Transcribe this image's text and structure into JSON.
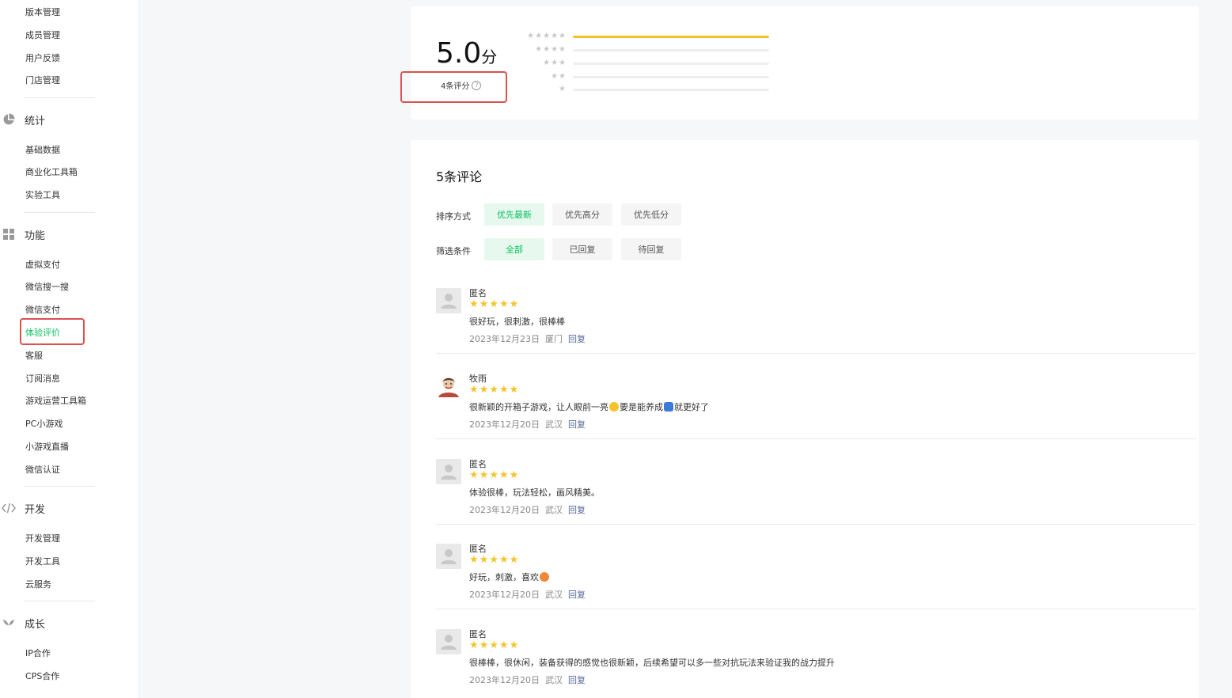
{
  "sidebar": {
    "items_top": [
      {
        "label": "版本管理"
      },
      {
        "label": "成员管理"
      },
      {
        "label": "用户反馈"
      },
      {
        "label": "门店管理"
      }
    ],
    "sections": [
      {
        "title": "统计",
        "icon": "pie-chart-icon",
        "items": [
          {
            "label": "基础数据"
          },
          {
            "label": "商业化工具箱"
          },
          {
            "label": "实验工具"
          }
        ]
      },
      {
        "title": "功能",
        "icon": "grid-icon",
        "items": [
          {
            "label": "虚拟支付"
          },
          {
            "label": "微信搜一搜"
          },
          {
            "label": "微信支付"
          },
          {
            "label": "体验评价",
            "active": true
          },
          {
            "label": "客服"
          },
          {
            "label": "订阅消息"
          },
          {
            "label": "游戏运营工具箱"
          },
          {
            "label": "PC小游戏"
          },
          {
            "label": "小游戏直播"
          },
          {
            "label": "微信认证"
          }
        ]
      },
      {
        "title": "开发",
        "icon": "code-icon",
        "items": [
          {
            "label": "开发管理"
          },
          {
            "label": "开发工具"
          },
          {
            "label": "云服务"
          }
        ]
      },
      {
        "title": "成长",
        "icon": "sprout-icon",
        "items": [
          {
            "label": "IP合作"
          },
          {
            "label": "CPS合作"
          }
        ]
      }
    ],
    "active_color": "#07c160"
  },
  "score": {
    "value": "5.0",
    "unit": "分",
    "count_label": "4条评分",
    "distribution": [
      {
        "stars": 5,
        "fraction": 1.0
      },
      {
        "stars": 4,
        "fraction": 0
      },
      {
        "stars": 3,
        "fraction": 0
      },
      {
        "stars": 2,
        "fraction": 0
      },
      {
        "stars": 1,
        "fraction": 0
      }
    ]
  },
  "comments": {
    "title": "5条评论",
    "sort_label": "排序方式",
    "sort_options": [
      "优先最新",
      "优先高分",
      "优先低分"
    ],
    "sort_selected": "优先最新",
    "filter_label": "筛选条件",
    "filter_options": [
      "全部",
      "已回复",
      "待回复"
    ],
    "filter_selected": "全部",
    "reply_label": "回复",
    "list": [
      {
        "author": "匿名",
        "rating": 5,
        "text": "很好玩，很刺激，很棒棒",
        "date": "2023年12月23日",
        "location": "厦门",
        "avatar": "default-avatar-icon"
      },
      {
        "author": "牧雨",
        "rating": 5,
        "text_parts": [
          "很新颖的开箱子游戏，让人眼前一亮",
          "要是能养成",
          "就更好了"
        ],
        "date": "2023年12月20日",
        "location": "武汉",
        "avatar": "user-avatar-image"
      },
      {
        "author": "匿名",
        "rating": 5,
        "text": "体验很棒，玩法轻松，画风精美。",
        "date": "2023年12月20日",
        "location": "武汉",
        "avatar": "default-avatar-icon"
      },
      {
        "author": "匿名",
        "rating": 5,
        "text": "好玩，刺激，喜欢",
        "date": "2023年12月20日",
        "location": "武汉",
        "avatar": "default-avatar-icon"
      },
      {
        "author": "匿名",
        "rating": 5,
        "text": "很棒棒，很休闲，装备获得的感觉也很新颖，后续希望可以多一些对抗玩法来验证我的战力提升",
        "date": "2023年12月20日",
        "location": "武汉",
        "avatar": "default-avatar-icon"
      }
    ]
  },
  "colors": {
    "accent": "#07c160",
    "star": "#f5c42c",
    "highlight": "#d9534f",
    "link": "#576b95"
  }
}
